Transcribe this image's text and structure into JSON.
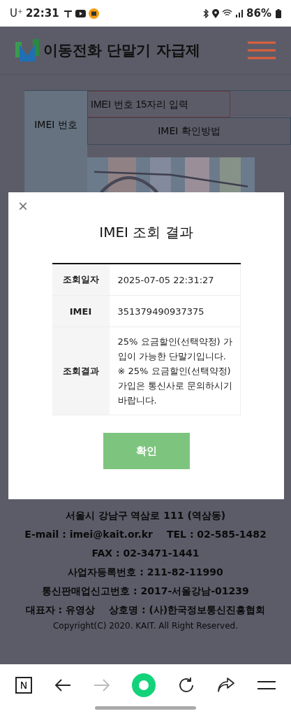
{
  "status_bar": {
    "carrier": "U⁺",
    "time": "22:31",
    "battery": "86%"
  },
  "header": {
    "title": "이동전화 단말기 자급제"
  },
  "form": {
    "label": "IMEI 번호",
    "input": {
      "placeholder": "IMEI 번호 15자리 입력"
    },
    "help_button": "IMEI 확인방법"
  },
  "modal": {
    "close": "×",
    "title": "IMEI 조회 결과",
    "rows": [
      {
        "label": "조회일자",
        "value": "2025-07-05 22:31:27"
      },
      {
        "label": "IMEI",
        "value": "351379490937375"
      },
      {
        "label": "조회결과",
        "value": "25% 요금할인(선택약정) 가입이 가능한 단말기입니다.\n※ 25% 요금할인(선택약정) 가입은 통신사로 문의하시기 바랍니다."
      }
    ],
    "confirm": "확인"
  },
  "footer": {
    "items": [
      "서울시 강남구 역삼로 111 (역삼동)",
      "E-mail : imei@kait.or.kr",
      "TEL : 02-585-1482",
      "FAX : 02-3471-1441",
      "사업자등록번호 : 211-82-11990",
      "통신판매업신고번호 : 2017-서울강남-01239",
      "대표자 : 유영상",
      "상호명 : (사)한국정보통신진흥협회"
    ],
    "copyright": "Copyright(C) 2020. KAIT. All Right Reserved."
  },
  "nav": {
    "home": "N"
  }
}
